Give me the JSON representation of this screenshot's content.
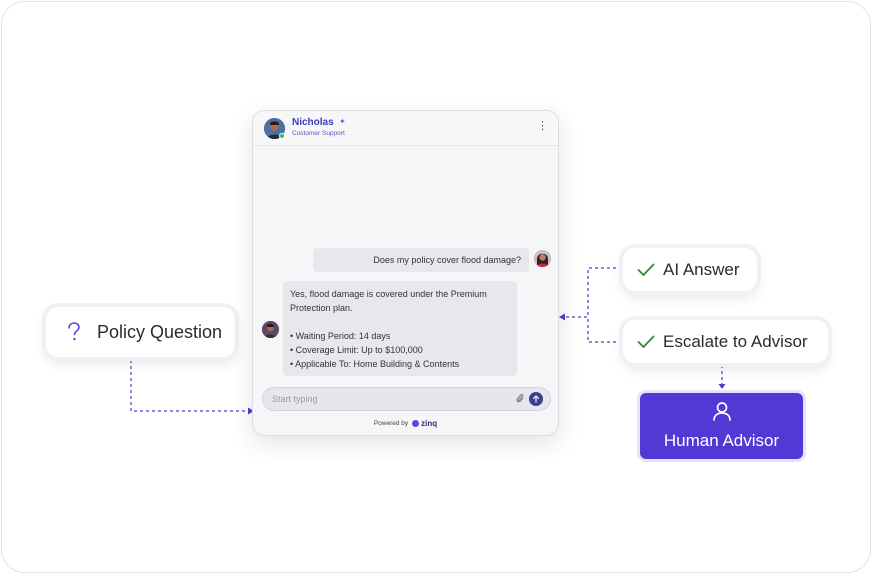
{
  "chat": {
    "agent_name": "Nicholas",
    "agent_role": "Customer Support",
    "user_message": "Does my policy cover flood damage?",
    "bot_message": {
      "line1": "Yes, flood damage is covered under the Premium",
      "line2": "Protection plan.",
      "bullets": [
        "• Waiting Period: 14 days",
        "• Coverage Limit: Up to $100,000",
        "• Applicable To: Home Building & Contents"
      ]
    },
    "input_placeholder": "Start typing",
    "powered_by": "Powered by",
    "brand": "zinq"
  },
  "flow": {
    "policy_question": "Policy Question",
    "ai_answer": "AI Answer",
    "escalate": "Escalate to Advisor",
    "human_advisor": "Human Advisor"
  },
  "colors": {
    "accent": "#5139d6",
    "check": "#2f8a3a",
    "connector": "#4a3fc4"
  },
  "icons": {
    "question": "question-icon",
    "check": "check-icon",
    "user": "user-icon",
    "attach": "paperclip-icon",
    "send": "send-arrow-icon",
    "menu": "kebab-menu-icon"
  }
}
